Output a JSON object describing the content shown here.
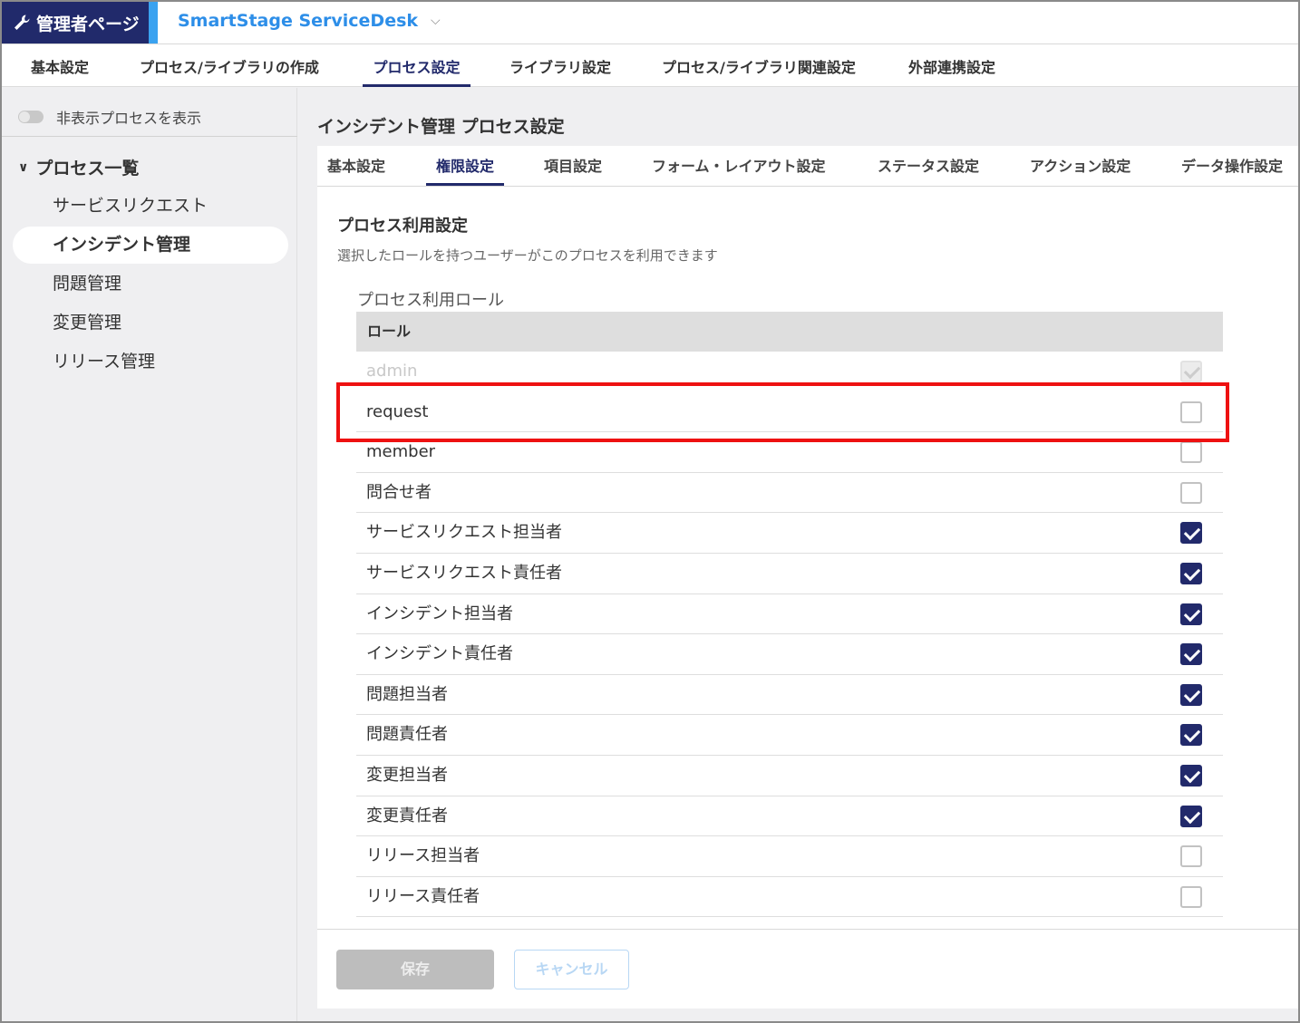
{
  "header": {
    "admin_label": "管理者ページ",
    "app_title": "SmartStage ServiceDesk"
  },
  "topnav": [
    "基本設定",
    "プロセス/ライブラリの作成",
    "プロセス設定",
    "ライブラリ設定",
    "プロセス/ライブラリ関連設定",
    "外部連携設定"
  ],
  "topnav_active": "プロセス設定",
  "sidebar": {
    "toggle_label": "非表示プロセスを表示",
    "list_title": "プロセス一覧",
    "items": [
      "サービスリクエスト",
      "インシデント管理",
      "問題管理",
      "変更管理",
      "リリース管理"
    ],
    "active": "インシデント管理"
  },
  "main": {
    "page_title": "インシデント管理 プロセス設定",
    "tabs": [
      "基本設定",
      "権限設定",
      "項目設定",
      "フォーム・レイアウト設定",
      "ステータス設定",
      "アクション設定",
      "データ操作設定"
    ],
    "active_tab": "権限設定",
    "section_title": "プロセス利用設定",
    "section_desc": "選択したロールを持つユーザーがこのプロセスを利用できます",
    "roles_label": "プロセス利用ロール",
    "table_header": "ロール",
    "roles": [
      {
        "name": "admin",
        "checked": true,
        "disabled": true
      },
      {
        "name": "request",
        "checked": false,
        "disabled": false
      },
      {
        "name": "member",
        "checked": false,
        "disabled": false
      },
      {
        "name": "問合せ者",
        "checked": false,
        "disabled": false
      },
      {
        "name": "サービスリクエスト担当者",
        "checked": true,
        "disabled": false
      },
      {
        "name": "サービスリクエスト責任者",
        "checked": true,
        "disabled": false
      },
      {
        "name": "インシデント担当者",
        "checked": true,
        "disabled": false
      },
      {
        "name": "インシデント責任者",
        "checked": true,
        "disabled": false
      },
      {
        "name": "問題担当者",
        "checked": true,
        "disabled": false
      },
      {
        "name": "問題責任者",
        "checked": true,
        "disabled": false
      },
      {
        "name": "変更担当者",
        "checked": true,
        "disabled": false
      },
      {
        "name": "変更責任者",
        "checked": true,
        "disabled": false
      },
      {
        "name": "リリース担当者",
        "checked": false,
        "disabled": false
      },
      {
        "name": "リリース責任者",
        "checked": false,
        "disabled": false
      }
    ],
    "save_label": "保存",
    "cancel_label": "キャンセル"
  },
  "colors": {
    "primary": "#222a6b",
    "accent": "#2d8ee8",
    "highlight": "#ee1111"
  }
}
